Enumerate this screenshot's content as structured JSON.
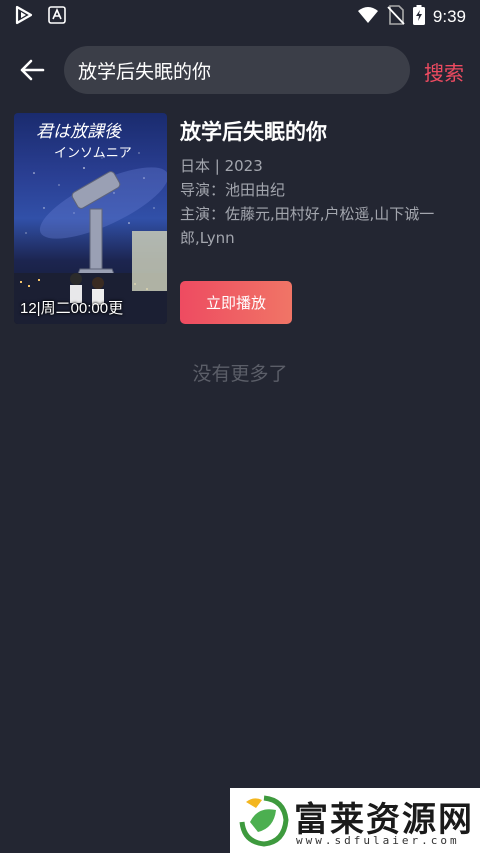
{
  "status_bar": {
    "time": "9:39",
    "icons": [
      "play-store-icon",
      "a-icon",
      "wifi-icon",
      "no-sim-icon",
      "battery-charging-icon"
    ]
  },
  "header": {
    "back_icon": "arrow-left-icon",
    "search_value": "放学后失眠的你",
    "search_button": "搜索"
  },
  "results": [
    {
      "title": "放学后失眠的你",
      "region_year": "日本 | 2023",
      "director": "导演：池田由纪",
      "cast": "主演：佐藤元,田村好,户松遥,山下诚一郎,Lynn",
      "poster_badge": "12|周二00:00更",
      "poster_title_art": "君は放課後インソムニア",
      "play_label": "立即播放"
    }
  ],
  "footer_text": "没有更多了",
  "watermark": {
    "name": "富莱资源网",
    "url": "www.sdfulaier.com"
  },
  "colors": {
    "background": "#232632",
    "accent": "#ee4b61",
    "search_bg": "#3b3e48",
    "muted_text": "#a3a6ae"
  }
}
